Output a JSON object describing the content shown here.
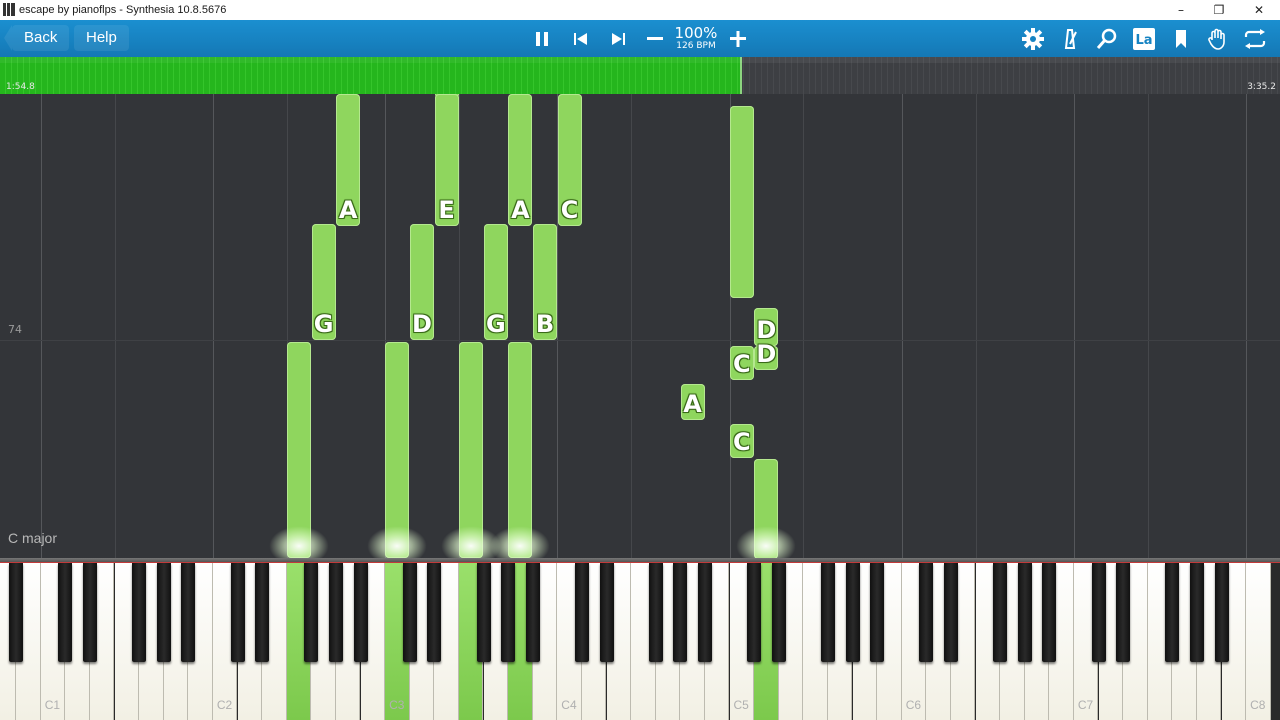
{
  "window": {
    "title": "escape by pianoflps - Synthesia 10.8.5676",
    "minimize": "–",
    "restore": "❐",
    "close": "✕"
  },
  "toolbar": {
    "back_label": "Back",
    "help_label": "Help",
    "speed_percent": "100%",
    "speed_bpm": "126 BPM",
    "icons": [
      "pause-icon",
      "skip-back-icon",
      "skip-forward-icon",
      "minus-icon",
      "plus-icon",
      "gear-icon",
      "metronome-icon",
      "magnifier-icon",
      "note-labels-icon",
      "bookmark-icon",
      "hand-icon",
      "loop-icon"
    ],
    "note_labels_text": "La",
    "accent_color": "#1a8acb"
  },
  "progress": {
    "elapsed": "1:54.8",
    "total": "3:35.2",
    "fraction": 0.578,
    "fill_color": "#2bbd22"
  },
  "notes": {
    "color": "#8fd65e",
    "falling": [
      {
        "label": "",
        "key": "E3"
      },
      {
        "label": "A",
        "key": "A2"
      },
      {
        "label": "E",
        "key": "E3"
      },
      {
        "label": "A",
        "key": "A3"
      },
      {
        "label": "C",
        "key": "C4"
      },
      {
        "label": "G",
        "key": "G2"
      },
      {
        "label": "D",
        "key": "D3"
      },
      {
        "label": "G",
        "key": "G3"
      },
      {
        "label": "B",
        "key": "B3"
      },
      {
        "label": "",
        "key": "F2"
      },
      {
        "label": "",
        "key": "C3"
      },
      {
        "label": "",
        "key": "F3"
      },
      {
        "label": "",
        "key": "A3"
      },
      {
        "label": "",
        "key": "C5"
      },
      {
        "label": "D",
        "key": "D5"
      },
      {
        "label": "D",
        "key": "D5"
      },
      {
        "label": "C",
        "key": "C5"
      },
      {
        "label": "A",
        "key": "A4"
      },
      {
        "label": "C",
        "key": "C5"
      },
      {
        "label": "",
        "key": "D5"
      }
    ]
  },
  "measure_number": "74",
  "key_signature": "C major",
  "keyboard": {
    "octave_labels": [
      "C1",
      "C2",
      "C3",
      "C4",
      "C5",
      "C6",
      "C7",
      "C8"
    ],
    "pressed_keys": [
      "F2",
      "C3",
      "F3",
      "A3",
      "D5"
    ],
    "press_color": "#86d05a"
  }
}
